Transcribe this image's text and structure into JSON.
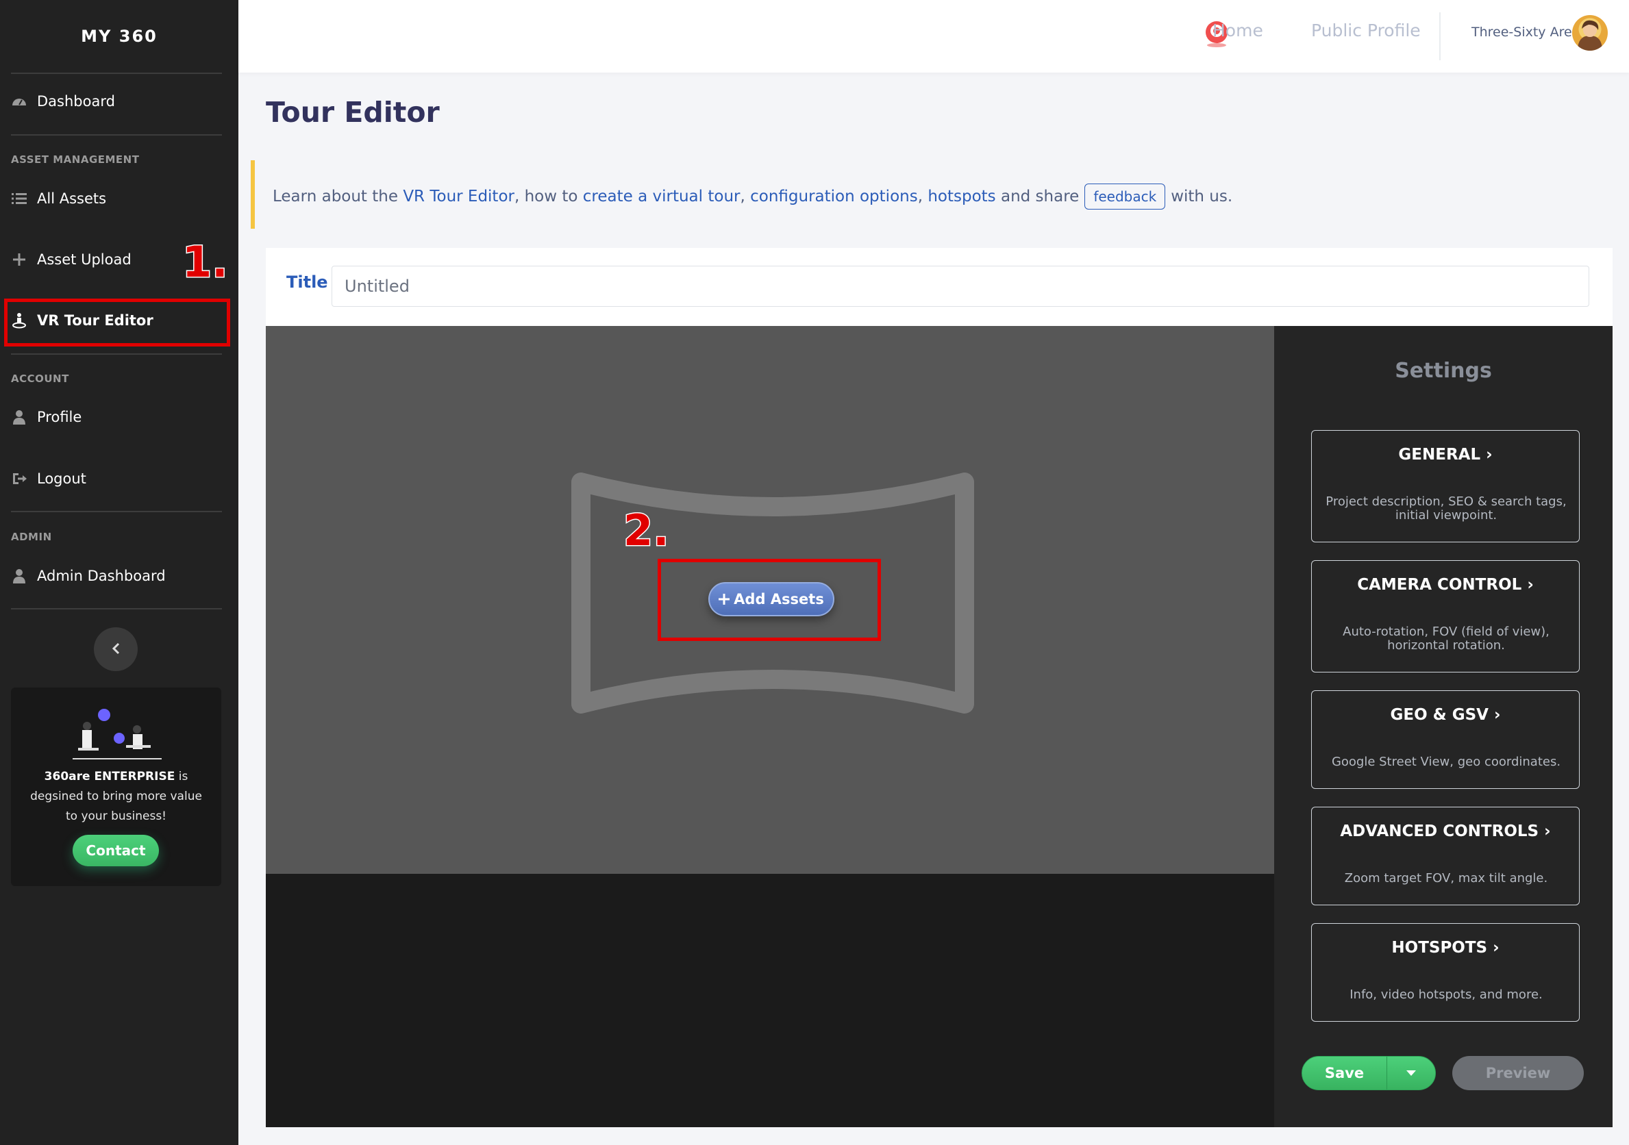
{
  "sidebar": {
    "brand": "MY 360",
    "items": {
      "dashboard": "Dashboard",
      "all_assets": "All Assets",
      "asset_upload": "Asset Upload",
      "vr_tour_editor": "VR Tour Editor",
      "profile": "Profile",
      "logout": "Logout",
      "admin_dashboard": "Admin Dashboard"
    },
    "sections": {
      "asset_management": "ASSET MANAGEMENT",
      "account": "ACCOUNT",
      "admin": "ADMIN"
    },
    "promo": {
      "brand": "360are ENTERPRISE",
      "text": "is degsined to bring more value to your business!",
      "button": "Contact"
    },
    "annotation_step": "1."
  },
  "topbar": {
    "home": "Home",
    "public_profile": "Public Profile",
    "user_name": "Three-Sixty Are"
  },
  "page": {
    "title": "Tour Editor"
  },
  "info": {
    "prefix": "Learn about the",
    "link_editor": "VR Tour Editor",
    "mid1": ", how to",
    "link_create": "create a virtual tour",
    "comma1": ",",
    "link_config": "configuration options",
    "comma2": ",",
    "link_hotspots": "hotspots",
    "mid2": "and share",
    "feedback": "feedback",
    "suffix": "with us."
  },
  "editor": {
    "title_label": "Title",
    "title_placeholder": "Untitled",
    "add_assets": "Add Assets",
    "annotation_step": "2."
  },
  "settings": {
    "title": "Settings",
    "cards": [
      {
        "heading": "GENERAL",
        "desc": "Project description, SEO & search tags, initial viewpoint."
      },
      {
        "heading": "CAMERA CONTROL",
        "desc": "Auto-rotation, FOV (field of view), horizontal rotation."
      },
      {
        "heading": "GEO & GSV",
        "desc": "Google Street View, geo coordinates."
      },
      {
        "heading": "ADVANCED CONTROLS",
        "desc": "Zoom target FOV, max tilt angle."
      },
      {
        "heading": "HOTSPOTS",
        "desc": "Info, video hotspots, and more."
      }
    ],
    "save": "Save",
    "preview": "Preview"
  },
  "colors": {
    "sidebar_bg": "#222222",
    "accent_link": "#2b5cb8",
    "highlight": "#e00000",
    "success": "#3ab764"
  },
  "icons": [
    "dashboard-icon",
    "list-icon",
    "plus-icon",
    "vr-icon",
    "user-icon",
    "logout-icon",
    "chevron-left-icon",
    "chevron-right-icon",
    "caret-down-icon",
    "plus-icon"
  ]
}
